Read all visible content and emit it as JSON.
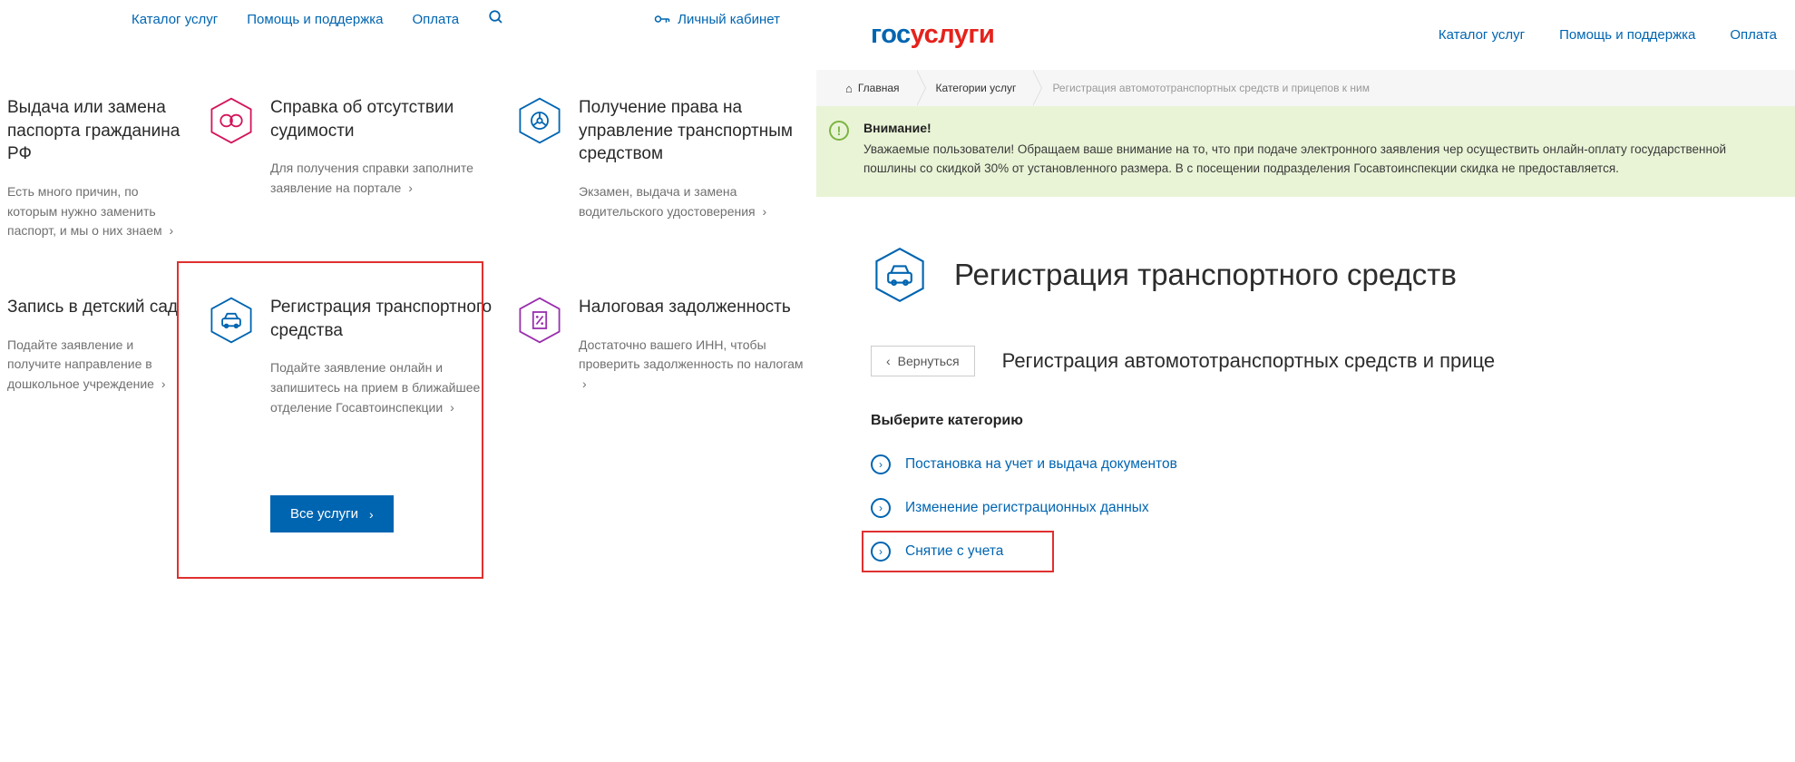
{
  "left": {
    "nav": {
      "catalog": "Каталог услуг",
      "help": "Помощь и поддержка",
      "pay": "Оплата",
      "account": "Личный кабинет"
    },
    "cards": {
      "passport": {
        "title": "Выдача или замена паспорта гражданина РФ",
        "desc": "Есть много причин, по которым нужно заменить паспорт, и мы о них знаем"
      },
      "criminal": {
        "title": "Справка об отсутствии судимости",
        "desc": "Для получения справки заполните заявление на портале"
      },
      "driving": {
        "title": "Получение права на управление транспортным средством",
        "desc": "Экзамен, выдача и замена водительского удостоверения"
      },
      "kindergarten": {
        "title": "Запись в детский сад",
        "desc": "Подайте заявление и получите направление в дошкольное учреждение"
      },
      "vehicle": {
        "title": "Регистрация транспортного средства",
        "desc": "Подайте заявление онлайн и запишитесь на прием в ближайшее отделение Госавтоинспекции"
      },
      "tax": {
        "title": "Налоговая задолженность",
        "desc": "Достаточно вашего ИНН, чтобы проверить задолженность по налогам"
      }
    },
    "all_services": "Все услуги"
  },
  "right": {
    "logo": {
      "part1": "гос",
      "part2": "услуги"
    },
    "nav": {
      "catalog": "Каталог услуг",
      "help": "Помощь и поддержка",
      "pay": "Оплата"
    },
    "breadcrumb": {
      "home": "Главная",
      "categories": "Категории услуг",
      "current": "Регистрация автомототранспортных средств и прицепов к ним"
    },
    "alert": {
      "title": "Внимание!",
      "body": "Уважаемые пользователи! Обращаем ваше внимание на то, что при подаче электронного заявления чер осуществить онлайн-оплату государственной пошлины со скидкой 30% от установленного размера. В с посещении подразделения Госавтоинспекции скидка не предоставляется."
    },
    "hero_title": "Регистрация транспортного средств",
    "back": "Вернуться",
    "subtitle": "Регистрация автомототранспортных средств и прице",
    "choose_category": "Выберите категорию",
    "categories": [
      "Постановка на учет и выдача документов",
      "Изменение регистрационных данных",
      "Снятие с учета"
    ]
  }
}
